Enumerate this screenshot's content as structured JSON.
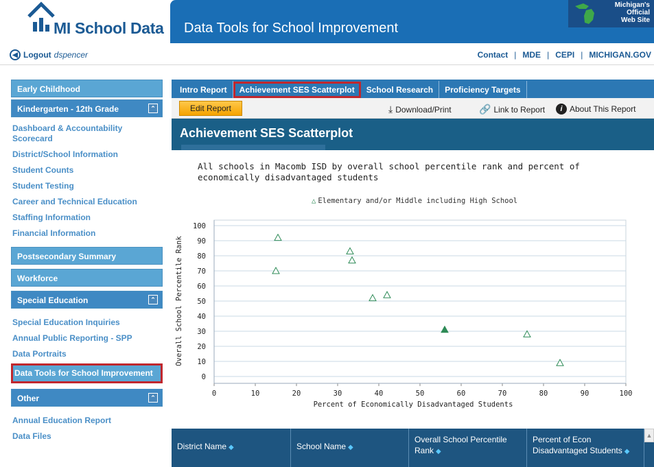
{
  "header": {
    "logo_text": "MI School Data",
    "app_title": "Data Tools for School Improvement",
    "badge_text_1": "Michigan's",
    "badge_text_2": "Official",
    "badge_text_3": "Web Site"
  },
  "subnav": {
    "logout_label": "Logout",
    "username": "dspencer",
    "links": [
      "Contact",
      "MDE",
      "CEPI",
      "MICHIGAN.GOV"
    ],
    "separator": "|"
  },
  "sidebar": {
    "sections": [
      {
        "label": "Early Childhood",
        "toggle": ""
      },
      {
        "label": "Kindergarten - 12th Grade",
        "toggle": "⌃",
        "items": [
          "Dashboard & Accountability Scorecard",
          "District/School Information",
          "Student Counts",
          "Student Testing",
          "Career and Technical Education",
          "Staffing Information",
          "Financial Information"
        ]
      },
      {
        "label": "Postsecondary Summary",
        "toggle": ""
      },
      {
        "label": "Workforce",
        "toggle": ""
      },
      {
        "label": "Special Education",
        "toggle": "⌃",
        "items": [
          "Special Education Inquiries",
          "Annual Public Reporting - SPP",
          "Data Portraits",
          "Data Tools for School Improvement"
        ]
      },
      {
        "label": "Other",
        "toggle": "⌃",
        "items": [
          "Annual Education Report",
          "Data Files"
        ]
      }
    ]
  },
  "tabs": [
    "Intro Report",
    "Achievement SES Scatterplot",
    "School Research",
    "Proficiency Targets"
  ],
  "toolbar": {
    "edit_label": "Edit Report",
    "download_label": "Download/Print",
    "link_label": "Link to Report",
    "about_label": "About This Report"
  },
  "report_title": "Achievement SES Scatterplot",
  "colors": {
    "brand_blue": "#1a6eb5",
    "sidebar_blue": "#5aa6d4",
    "highlight_red": "#c0272d",
    "marker_green": "#2e8b57"
  },
  "chart_data": {
    "type": "scatter",
    "title": "All schools in Macomb ISD by overall school percentile rank and percent of economically disadvantaged students",
    "legend": "Elementary and/or Middle including High School",
    "xlabel": "Percent of Economically Disadvantaged Students",
    "ylabel": "Overall School Percentile Rank",
    "xlim": [
      0,
      100
    ],
    "ylim": [
      0,
      100
    ],
    "x_ticks": [
      0,
      10,
      20,
      30,
      40,
      50,
      60,
      70,
      80,
      90,
      100
    ],
    "y_ticks": [
      0,
      10,
      20,
      30,
      40,
      50,
      60,
      70,
      80,
      90,
      100
    ],
    "grid": true,
    "legend_position": "top-center",
    "series": [
      {
        "name": "Elementary and/or Middle including High School",
        "points": [
          {
            "x": 15.5,
            "y": 92,
            "filled": false
          },
          {
            "x": 15,
            "y": 70,
            "filled": false
          },
          {
            "x": 33,
            "y": 83,
            "filled": false
          },
          {
            "x": 33.5,
            "y": 77,
            "filled": false
          },
          {
            "x": 38.5,
            "y": 52,
            "filled": false
          },
          {
            "x": 42,
            "y": 54,
            "filled": false
          },
          {
            "x": 56,
            "y": 31,
            "filled": true
          },
          {
            "x": 76,
            "y": 28,
            "filled": false
          },
          {
            "x": 84,
            "y": 9,
            "filled": false
          }
        ]
      }
    ]
  },
  "table": {
    "columns": [
      "District Name",
      "School Name",
      "Overall School Percentile Rank",
      "Percent of Econ Disadvantaged Students"
    ],
    "sort_icon": "◆"
  }
}
